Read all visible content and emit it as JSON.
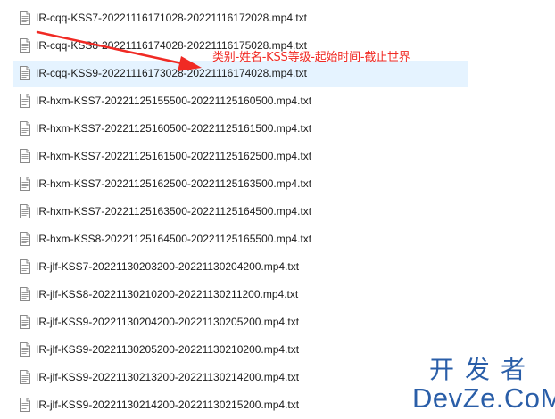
{
  "files": [
    {
      "name": "IR-cqq-KSS7-20221116171028-20221116172028.mp4.txt",
      "selected": false
    },
    {
      "name": "IR-cqq-KSS8-20221116174028-20221116175028.mp4.txt",
      "selected": false
    },
    {
      "name": "IR-cqq-KSS9-20221116173028-20221116174028.mp4.txt",
      "selected": true
    },
    {
      "name": "IR-hxm-KSS7-20221125155500-20221125160500.mp4.txt",
      "selected": false
    },
    {
      "name": "IR-hxm-KSS7-20221125160500-20221125161500.mp4.txt",
      "selected": false
    },
    {
      "name": "IR-hxm-KSS7-20221125161500-20221125162500.mp4.txt",
      "selected": false
    },
    {
      "name": "IR-hxm-KSS7-20221125162500-20221125163500.mp4.txt",
      "selected": false
    },
    {
      "name": "IR-hxm-KSS7-20221125163500-20221125164500.mp4.txt",
      "selected": false
    },
    {
      "name": "IR-hxm-KSS8-20221125164500-20221125165500.mp4.txt",
      "selected": false
    },
    {
      "name": "IR-jlf-KSS7-20221130203200-20221130204200.mp4.txt",
      "selected": false
    },
    {
      "name": "IR-jlf-KSS8-20221130210200-20221130211200.mp4.txt",
      "selected": false
    },
    {
      "name": "IR-jlf-KSS9-20221130204200-20221130205200.mp4.txt",
      "selected": false
    },
    {
      "name": "IR-jlf-KSS9-20221130205200-20221130210200.mp4.txt",
      "selected": false
    },
    {
      "name": "IR-jlf-KSS9-20221130213200-20221130214200.mp4.txt",
      "selected": false
    },
    {
      "name": "IR-jlf-KSS9-20221130214200-20221130215200.mp4.txt",
      "selected": false
    }
  ],
  "file_icon": "text-file-icon",
  "annotation": {
    "text": "类别-姓名-KSS等级-起始时间-截止世界",
    "color": "#f02a24"
  },
  "watermark": {
    "line1": "开发者",
    "line2": "DevZe.CoM",
    "color": "#2a5ea8"
  },
  "colors": {
    "selected_row": "#e5f3ff",
    "text": "#1b1b1b"
  }
}
